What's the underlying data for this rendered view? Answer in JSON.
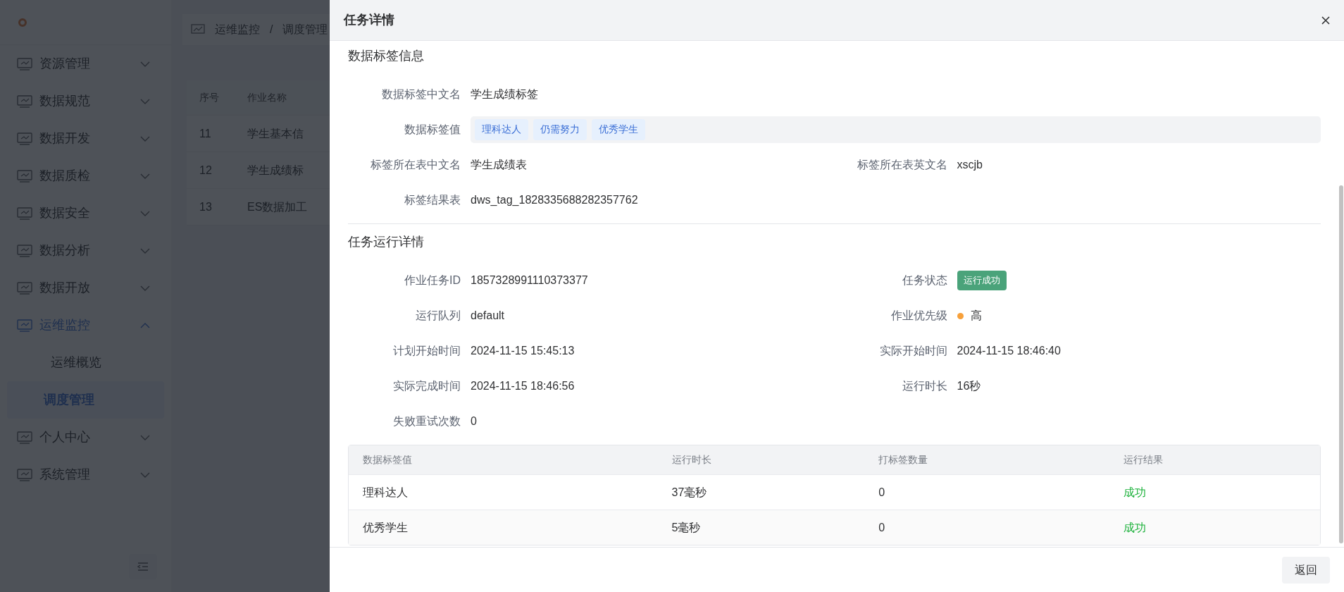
{
  "sidebar": {
    "items": [
      {
        "label": "资源管理",
        "expanded": false
      },
      {
        "label": "数据规范",
        "expanded": false
      },
      {
        "label": "数据开发",
        "expanded": false
      },
      {
        "label": "数据质检",
        "expanded": false
      },
      {
        "label": "数据安全",
        "expanded": false
      },
      {
        "label": "数据分析",
        "expanded": false
      },
      {
        "label": "数据开放",
        "expanded": false
      },
      {
        "label": "运维监控",
        "expanded": true,
        "children": [
          {
            "label": "运维概览",
            "selected": false
          },
          {
            "label": "调度管理",
            "selected": true
          }
        ]
      },
      {
        "label": "个人中心",
        "expanded": false
      },
      {
        "label": "系统管理",
        "expanded": false
      }
    ]
  },
  "breadcrumb": {
    "items": [
      "运维监控",
      "调度管理"
    ],
    "separator": "/"
  },
  "job_table": {
    "columns": [
      "序号",
      "作业名称"
    ],
    "rows": [
      [
        "11",
        "学生基本信"
      ],
      [
        "12",
        "学生成绩标"
      ],
      [
        "13",
        "ES数据加工"
      ]
    ]
  },
  "drawer": {
    "title": "任务详情",
    "sections": [
      {
        "title": "数据标签信息",
        "rows": [
          [
            {
              "label": "数据标签中文名",
              "kind": "text",
              "value": "学生成绩标签"
            }
          ],
          [
            {
              "label": "数据标签值",
              "kind": "tags",
              "tags": [
                "理科达人",
                "仍需努力",
                "优秀学生"
              ]
            }
          ],
          [
            {
              "label": "标签所在表中文名",
              "kind": "text",
              "value": "学生成绩表"
            },
            {
              "label": "标签所在表英文名",
              "kind": "text",
              "value": "xscjb"
            }
          ],
          [
            {
              "label": "标签结果表",
              "kind": "text",
              "value": "dws_tag_1828335688282357762"
            }
          ]
        ]
      },
      {
        "title": "任务运行详情",
        "rows": [
          [
            {
              "label": "作业任务ID",
              "kind": "text",
              "value": "1857328991110373377"
            },
            {
              "label": "任务状态",
              "kind": "badge",
              "value": "运行成功"
            }
          ],
          [
            {
              "label": "运行队列",
              "kind": "text",
              "value": "default"
            },
            {
              "label": "作业优先级",
              "kind": "priority",
              "value": "高",
              "color": "#f7a03a"
            }
          ],
          [
            {
              "label": "计划开始时间",
              "kind": "text",
              "value": "2024-11-15 15:45:13"
            },
            {
              "label": "实际开始时间",
              "kind": "text",
              "value": "2024-11-15 18:46:40"
            }
          ],
          [
            {
              "label": "实际完成时间",
              "kind": "text",
              "value": "2024-11-15 18:46:56"
            },
            {
              "label": "运行时长",
              "kind": "text",
              "value": "16秒"
            }
          ],
          [
            {
              "label": "失败重试次数",
              "kind": "text",
              "value": "0"
            }
          ]
        ]
      }
    ],
    "result_table": {
      "columns": [
        "数据标签值",
        "运行时长",
        "打标签数量",
        "运行结果"
      ],
      "rows": [
        {
          "tag": "理科达人",
          "duration": "37毫秒",
          "count": "0",
          "result": "成功",
          "success": true
        },
        {
          "tag": "优秀学生",
          "duration": "5毫秒",
          "count": "0",
          "result": "成功",
          "success": true
        }
      ]
    },
    "footer_button": "返回"
  }
}
